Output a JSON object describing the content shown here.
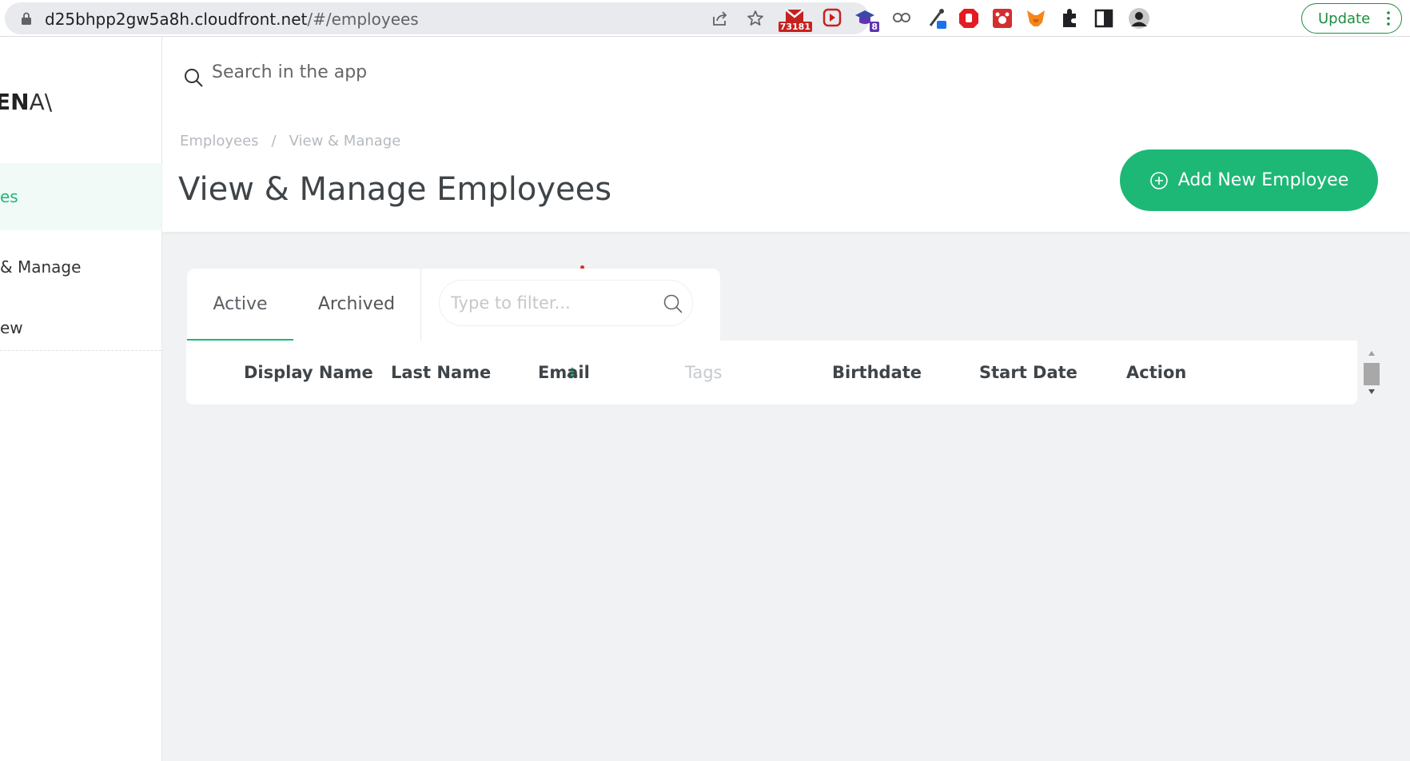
{
  "browser": {
    "url_host": "d25bhpp2gw5a8h.cloudfront.net",
    "url_path": "/#/employees",
    "gmail_badge": "73181",
    "ext_badge_count": "8",
    "update_label": "Update"
  },
  "sidebar": {
    "logo_bold": "N",
    "logo_rest": "A\\",
    "logo_prefix": "E",
    "items": [
      {
        "label": "es"
      },
      {
        "label": "& Manage"
      },
      {
        "label": "ew"
      }
    ]
  },
  "header": {
    "search_placeholder": "Search in the app",
    "breadcrumb": [
      "Employees",
      "View & Manage"
    ],
    "breadcrumb_sep": "/",
    "title": "View & Manage Employees",
    "add_button_label": "Add New Employee"
  },
  "tabs": [
    {
      "label": "Active"
    },
    {
      "label": "Archived"
    }
  ],
  "filter": {
    "placeholder": "Type to filter..."
  },
  "table": {
    "columns": [
      "Display Name",
      "Last Name",
      "Email",
      "Tags",
      "Birthdate",
      "Start Date",
      "Action"
    ]
  },
  "colors": {
    "accent": "#1db876",
    "background": "#f0f2f3"
  }
}
